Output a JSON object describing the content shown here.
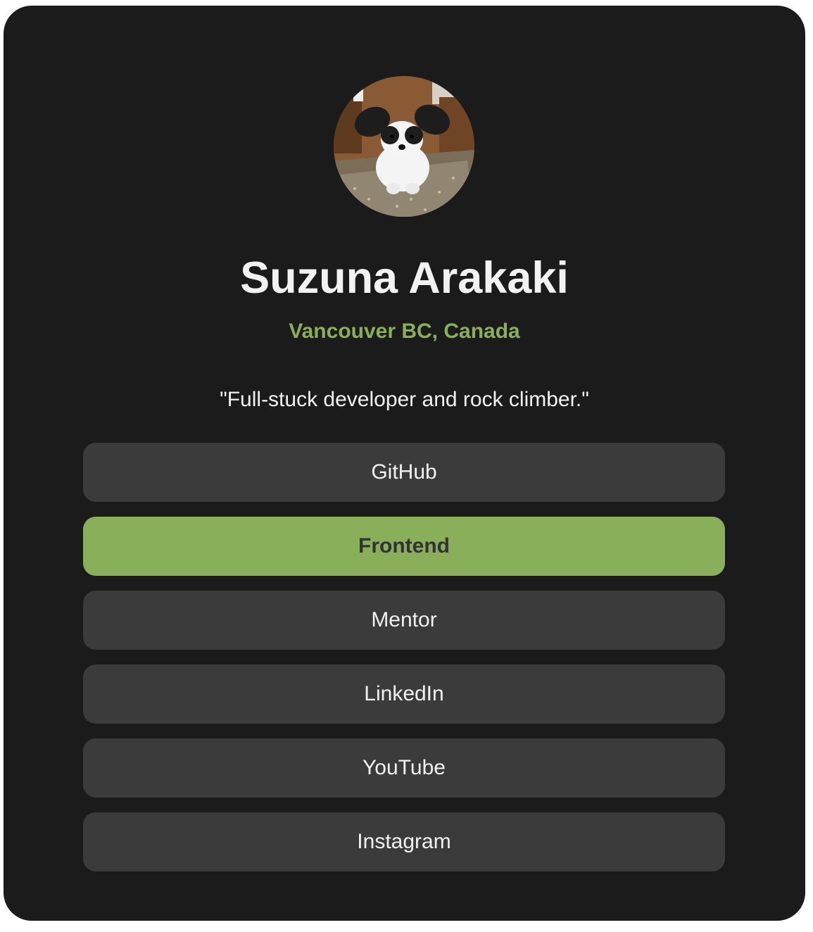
{
  "profile": {
    "name": "Suzuna Arakaki",
    "location": "Vancouver BC, Canada",
    "bio": "\"Full-stuck developer and rock climber.\""
  },
  "links": [
    {
      "label": "GitHub",
      "active": false
    },
    {
      "label": "Frontend",
      "active": true
    },
    {
      "label": "Mentor",
      "active": false
    },
    {
      "label": "LinkedIn",
      "active": false
    },
    {
      "label": "YouTube",
      "active": false
    },
    {
      "label": "Instagram",
      "active": false
    }
  ],
  "colors": {
    "card_background": "#1b1b1b",
    "button_background": "#3b3b3b",
    "accent": "#8aaf5b",
    "text": "#f2f2f2"
  }
}
